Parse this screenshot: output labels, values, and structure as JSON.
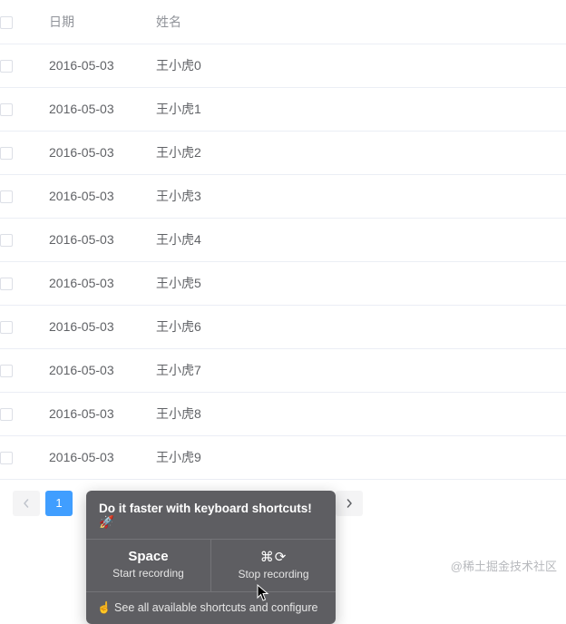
{
  "table": {
    "headers": {
      "date": "日期",
      "name": "姓名"
    },
    "rows": [
      {
        "date": "2016-05-03",
        "name": "王小虎0"
      },
      {
        "date": "2016-05-03",
        "name": "王小虎1"
      },
      {
        "date": "2016-05-03",
        "name": "王小虎2"
      },
      {
        "date": "2016-05-03",
        "name": "王小虎3"
      },
      {
        "date": "2016-05-03",
        "name": "王小虎4"
      },
      {
        "date": "2016-05-03",
        "name": "王小虎5"
      },
      {
        "date": "2016-05-03",
        "name": "王小虎6"
      },
      {
        "date": "2016-05-03",
        "name": "王小虎7"
      },
      {
        "date": "2016-05-03",
        "name": "王小虎8"
      },
      {
        "date": "2016-05-03",
        "name": "王小虎9"
      }
    ]
  },
  "pagination": {
    "current": 1,
    "pages": [
      "1"
    ]
  },
  "tooltip": {
    "title": "Do it faster with keyboard shortcuts! 🚀",
    "start_key": "Space",
    "start_label": "Start recording",
    "stop_key": "⌘⟳",
    "stop_label": "Stop recording",
    "footer": "☝️ See all available shortcuts and configure"
  },
  "watermark": "@稀土掘金技术社区"
}
